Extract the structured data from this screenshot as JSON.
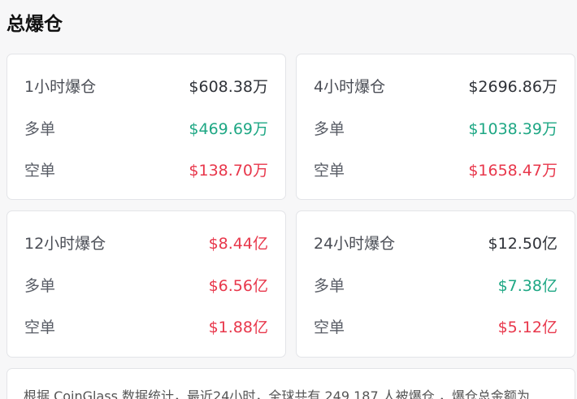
{
  "header": {
    "title": "总爆仓"
  },
  "cards": [
    {
      "period": "1小时爆仓",
      "total": "$608.38万",
      "long_label": "多单",
      "long": "$469.69万",
      "short_label": "空单",
      "short": "$138.70万"
    },
    {
      "period": "4小时爆仓",
      "total": "$2696.86万",
      "long_label": "多单",
      "long": "$1038.39万",
      "short_label": "空单",
      "short": "$1658.47万"
    },
    {
      "period": "12小时爆仓",
      "total": "$8.44亿",
      "long_label": "多单",
      "long": "$6.56亿",
      "short_label": "空单",
      "short": "$1.88亿"
    },
    {
      "period": "24小时爆仓",
      "total": "$12.50亿",
      "long_label": "多单",
      "long": "$7.38亿",
      "short_label": "空单",
      "short": "$5.12亿"
    }
  ],
  "note": {
    "text": "根据 CoinGlass 数据统计，最近24小时，全球共有 249,187 人被爆仓 ，爆仓总金额为"
  },
  "colors": {
    "green": "#1ea784",
    "red": "#e8374b"
  }
}
